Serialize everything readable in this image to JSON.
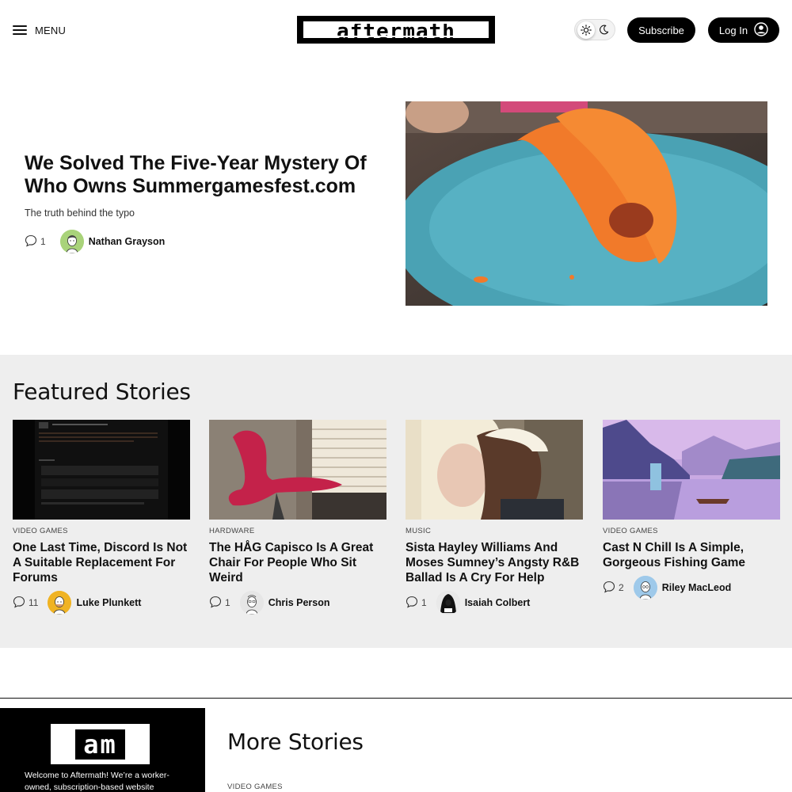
{
  "header": {
    "menu_label": "MENU",
    "logo_text": "aftermath",
    "subscribe_label": "Subscribe",
    "login_label": "Log In"
  },
  "hero": {
    "title": "We Solved The Five-Year Mystery Of Who Owns Summergamesfest.com",
    "subtitle": "The truth behind the typo",
    "comments": "1",
    "author": "Nathan Grayson"
  },
  "featured": {
    "heading": "Featured Stories",
    "cards": [
      {
        "category": "VIDEO GAMES",
        "title": "One Last Time, Discord Is Not A Suitable Replacement For Forums",
        "comments": "11",
        "author": "Luke Plunkett"
      },
      {
        "category": "HARDWARE",
        "title": "The HÅG Capisco Is A Great Chair For People Who Sit Weird",
        "comments": "1",
        "author": "Chris Person"
      },
      {
        "category": "MUSIC",
        "title": "Sista Hayley Williams And Moses Sumney’s Angsty R&B Ballad Is A Cry For Help",
        "comments": "1",
        "author": "Isaiah Colbert"
      },
      {
        "category": "VIDEO GAMES",
        "title": "Cast N Chill Is A Simple, Gorgeous Fishing Game",
        "comments": "2",
        "author": "Riley MacLeod"
      }
    ]
  },
  "side": {
    "logo_text": "am",
    "welcome": "Welcome to Aftermath! We’re a worker-owned, subscription-based website"
  },
  "more": {
    "heading": "More Stories",
    "first_category": "VIDEO GAMES"
  }
}
